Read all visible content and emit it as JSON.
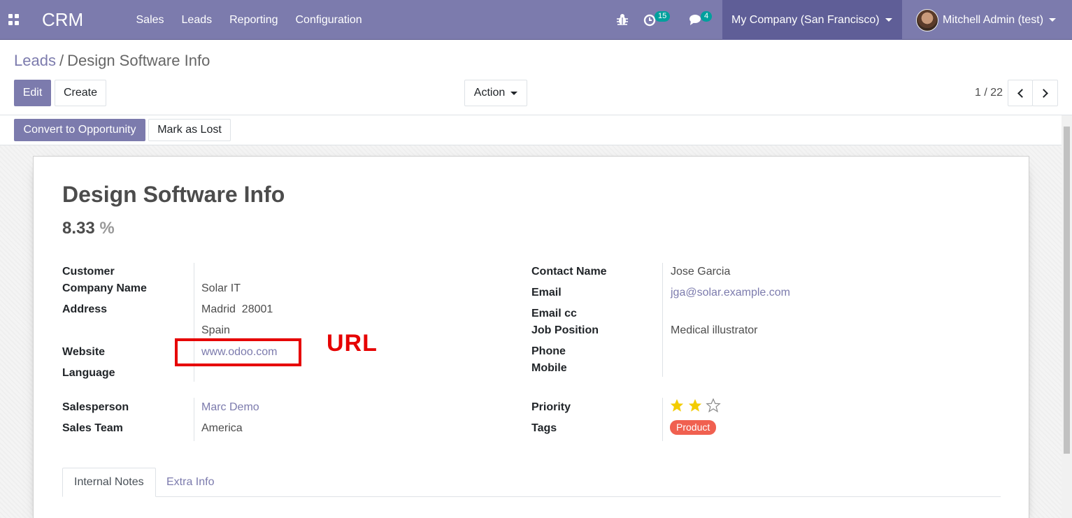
{
  "navbar": {
    "brand": "CRM",
    "menu": [
      "Sales",
      "Leads",
      "Reporting",
      "Configuration"
    ],
    "activity_count": "15",
    "message_count": "4",
    "company": "My Company (San Francisco)",
    "user": "Mitchell Admin (test)"
  },
  "breadcrumb": {
    "parent": "Leads",
    "separator": "/",
    "current": "Design Software Info"
  },
  "buttons": {
    "edit": "Edit",
    "create": "Create",
    "action": "Action",
    "convert": "Convert to Opportunity",
    "mark_lost": "Mark as Lost"
  },
  "pager": {
    "value": "1 / 22"
  },
  "record": {
    "title": "Design Software Info",
    "probability": "8.33",
    "probability_unit": "%",
    "left_fields": {
      "customer_label": "Customer",
      "customer_value": "",
      "company_label": "Company Name",
      "company_value": "Solar IT",
      "address_label": "Address",
      "address_line1": "Madrid  28001",
      "address_line2": "Spain",
      "website_label": "Website",
      "website_value": "www.odoo.com",
      "language_label": "Language",
      "language_value": ""
    },
    "right_fields": {
      "contact_label": "Contact Name",
      "contact_value": "Jose Garcia",
      "email_label": "Email",
      "email_value": "jga@solar.example.com",
      "emailcc_label": "Email cc",
      "job_label": "Job Position",
      "job_value": "Medical illustrator",
      "phone_label": "Phone",
      "mobile_label": "Mobile"
    },
    "sales": {
      "salesperson_label": "Salesperson",
      "salesperson_value": "Marc Demo",
      "team_label": "Sales Team",
      "team_value": "America"
    },
    "priority": {
      "label": "Priority",
      "stars_filled": 2,
      "stars_total": 3
    },
    "tags": {
      "label": "Tags",
      "values": [
        "Product"
      ],
      "color": "#f06050"
    }
  },
  "annotation": {
    "text": "URL",
    "color": "#e60000"
  },
  "tabs": [
    "Internal Notes",
    "Extra Info"
  ],
  "colors": {
    "primary": "#7c7bad",
    "company_bg": "#5f5e97",
    "badge": "#00a09d",
    "star": "#f3cc00"
  }
}
